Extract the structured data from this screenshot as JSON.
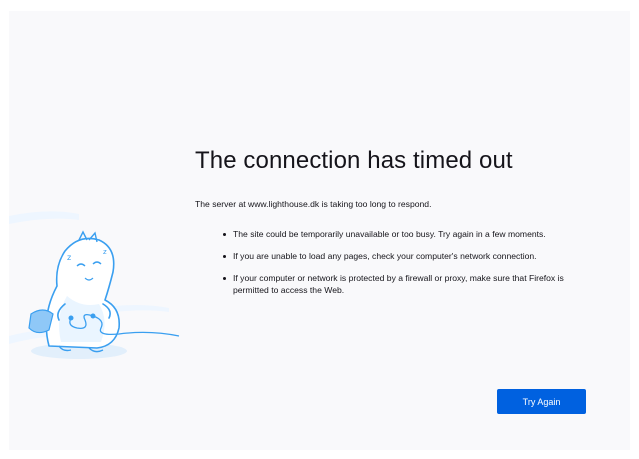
{
  "error_page": {
    "title": "The connection has timed out",
    "intro": "The server at www.lighthouse.dk is taking too long to respond.",
    "bullets": [
      "The site could be temporarily unavailable or too busy. Try again in a few moments.",
      "If you are unable to load any pages, check your computer's network connection.",
      "If your computer or network is protected by a firewall or proxy, make sure that Firefox is permitted to access the Web."
    ],
    "try_again_label": "Try Again",
    "illustration": "timed-out-dinosaur-illustration"
  },
  "colors": {
    "page_background": "#f9f9fb",
    "text": "#15141a",
    "button_background": "#0061e0",
    "button_text": "#ffffff",
    "illustration_stroke": "#3a9ff0",
    "illustration_fill": "#e8f4ff"
  }
}
